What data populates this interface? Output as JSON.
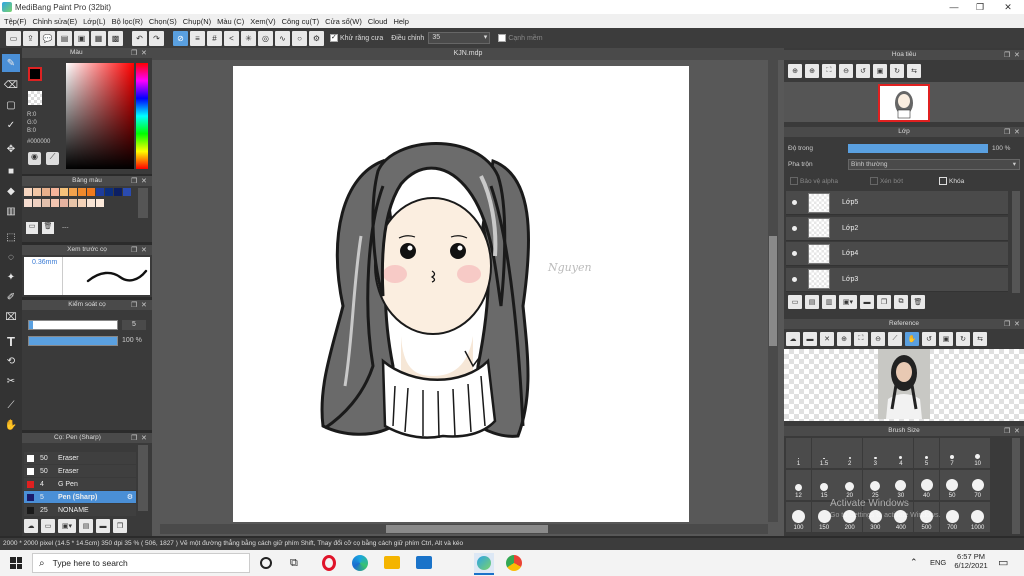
{
  "window": {
    "title": "MediBang Paint Pro (32bit)"
  },
  "menu": [
    "Tệp(F)",
    "Chỉnh sửa(E)",
    "Lớp(L)",
    "Bộ lọc(R)",
    "Chọn(S)",
    "Chụp(N)",
    "Màu (C)",
    "Xem(V)",
    "Công cụ(T)",
    "Cửa sổ(W)",
    "Cloud",
    "Help"
  ],
  "toolbar": {
    "antialias_label": "Khử răng cưa",
    "correction_label": "Điều chỉnh",
    "correction_value": "35",
    "canh_mem_label": "Cạnh mềm"
  },
  "color_panel": {
    "title": "Màu",
    "r": "R:0",
    "g": "G:0",
    "b": "B:0",
    "hex": "#000000",
    "primary_color": "#000000",
    "secondary_color": "#ffffff"
  },
  "palette_panel": {
    "title": "Bảng màu",
    "dash": "---",
    "swatches": [
      "#f6d6c0",
      "#f2c6a5",
      "#e8b08c",
      "#f5b49a",
      "#f6c27a",
      "#f3a24c",
      "#f08a2d",
      "#f07a1e",
      "#1d3c9c",
      "#0b2e7e",
      "#0c1f63",
      "#2a4bb0",
      "#f7ddd0",
      "#efd0c1",
      "#e3c0ac",
      "#f3c5b0",
      "#e6b3a0",
      "#e8c4a8",
      "#f4d3b8",
      "#f7e4d4",
      "#fce9da"
    ]
  },
  "brush_preview": {
    "title": "Xem trước cọ",
    "size": "0.36mm"
  },
  "brush_control": {
    "title": "Kiểm soát cọ",
    "size": "5",
    "opacity": "100 %"
  },
  "brush_list": {
    "title": "Cọ: Pen (Sharp)",
    "items": [
      {
        "size": "50",
        "name": "Eraser",
        "color": "#ffffff",
        "selected": false
      },
      {
        "size": "50",
        "name": "Eraser",
        "color": "#ffffff",
        "selected": false
      },
      {
        "size": "4",
        "name": "G Pen",
        "color": "#e02020",
        "selected": false
      },
      {
        "size": "5",
        "name": "Pen (Sharp)",
        "color": "#1a1a6a",
        "selected": true
      },
      {
        "size": "25",
        "name": "NONAME",
        "color": "#1a1a1a",
        "selected": false
      }
    ]
  },
  "document": {
    "tab": "KJN.mdp",
    "signature": "Nguyen"
  },
  "navigator": {
    "title": "Hoa tiêu"
  },
  "layer_panel": {
    "title": "Lớp",
    "opacity_label": "Độ trong",
    "opacity_value": "100 %",
    "opacity_fraction": 1.0,
    "blend_label": "Pha trộn",
    "blend_value": "Bình thường",
    "protect_alpha": "Bảo vệ alpha",
    "clip": "Xén bớt",
    "lock": "Khóa",
    "layers": [
      "Lớp5",
      "Lớp2",
      "Lớp4",
      "Lớp3"
    ]
  },
  "reference_panel": {
    "title": "Reference"
  },
  "brush_size_panel": {
    "title": "Brush Size",
    "row1": [
      "1",
      "1.5",
      "2",
      "3",
      "4",
      "5",
      "7",
      "10"
    ],
    "row2": [
      "12",
      "15",
      "20",
      "25",
      "30",
      "40",
      "50",
      "70"
    ],
    "row3": [
      "100",
      "150",
      "200",
      "300",
      "400",
      "500",
      "700",
      "1000"
    ]
  },
  "status": {
    "text": "2000 * 2000 pixel   (14.5 * 14.5cm)   350 dpi   35 %   ( 506, 1827 )   Vẽ một đường thẳng bằng cách giữ phím Shift, Thay đổi cỡ cọ bằng cách giữ phím Ctrl, Alt và kéo"
  },
  "taskbar": {
    "search_placeholder": "Type here to search",
    "lang": "ENG",
    "time": "6:57 PM",
    "date": "6/12/2021"
  },
  "watermark": {
    "line1": "Activate Windows",
    "line2": "Go to Settings to activate Windows."
  },
  "colors": {
    "accent": "#4a8fd6",
    "panel": "#3a3a3a",
    "canvas_bg": "#585858"
  }
}
